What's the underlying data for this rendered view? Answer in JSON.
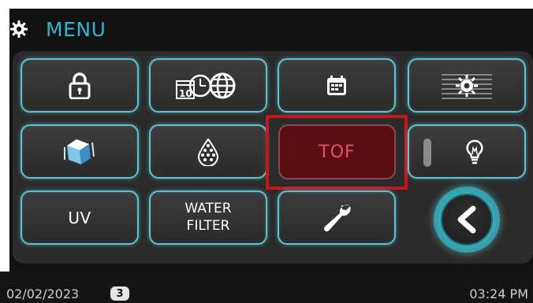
{
  "header": {
    "title": "MENU",
    "icon": "gear-icon"
  },
  "buttons": {
    "lock": {
      "icon": "lock-icon"
    },
    "datetime": {
      "icon": "calendar-clock-globe-icon",
      "calendar_number": "10"
    },
    "calendar": {
      "icon": "calendar-icon"
    },
    "display": {
      "icon": "brightness-settings-icon"
    },
    "ice": {
      "icon": "ice-cube-icon"
    },
    "dispense": {
      "icon": "water-drop-icon"
    },
    "tof": {
      "label": "TOF",
      "highlight_color": "#c8161c"
    },
    "light": {
      "icon": "light-bulb-icon"
    },
    "uv": {
      "label": "UV"
    },
    "water_filter": {
      "label_line1": "WATER",
      "label_line2": "FILTER"
    },
    "service": {
      "icon": "wrench-icon"
    },
    "back": {
      "icon": "back-chevron-icon"
    }
  },
  "status": {
    "date": "02/02/2023",
    "badge": "3",
    "time": "03:24 PM"
  },
  "colors": {
    "accent": "#5fc4cd",
    "title": "#2fb6d6",
    "tof_text": "#e0507a",
    "tof_bg": "#5b0c0f"
  }
}
